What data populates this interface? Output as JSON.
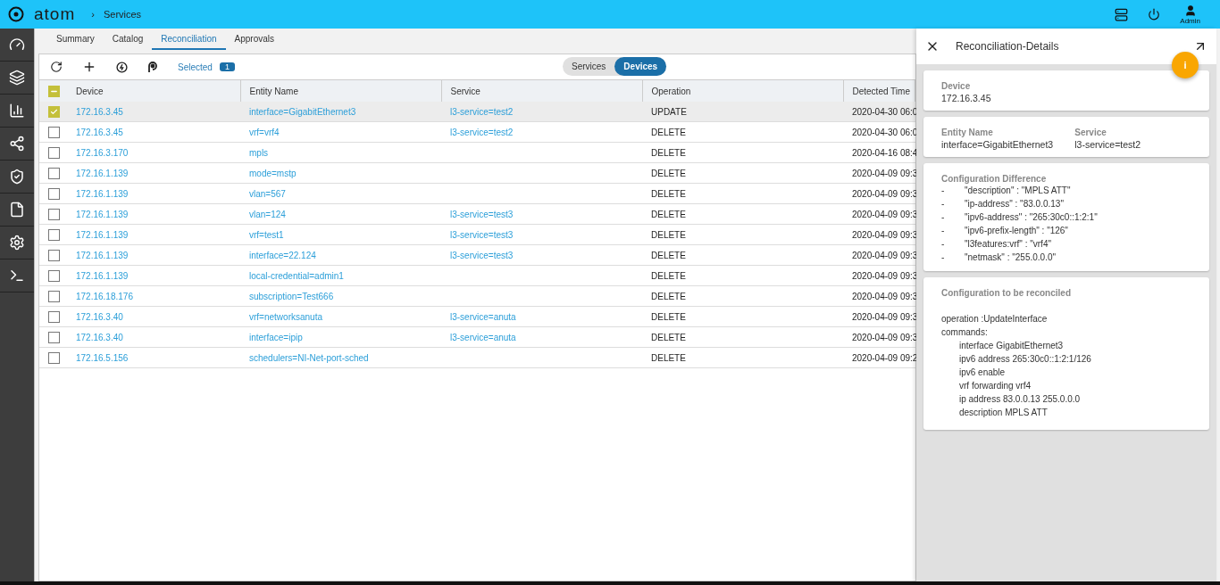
{
  "header": {
    "logo": "atom",
    "separator": "›",
    "breadcrumb": "Services",
    "user": "Admin"
  },
  "tabs": [
    {
      "label": "Summary",
      "selected": false
    },
    {
      "label": "Catalog",
      "selected": false
    },
    {
      "label": "Reconciliation",
      "selected": true
    },
    {
      "label": "Approvals",
      "selected": false
    }
  ],
  "toolbar": {
    "selected_label": "Selected",
    "selected_count": "1",
    "toggle": [
      {
        "label": "Services",
        "selected": false
      },
      {
        "label": "Devices",
        "selected": true
      }
    ]
  },
  "table": {
    "columns": [
      "Device",
      "Entity Name",
      "Service",
      "Operation",
      "Detected Time"
    ],
    "header_checkbox": {
      "partial": true
    },
    "rows": [
      {
        "checked": true,
        "device": "172.16.3.45",
        "entity": "interface=GigabitEthernet3",
        "service": "l3-service=test2",
        "operation": "UPDATE",
        "time": "2020-04-30 06:0"
      },
      {
        "checked": false,
        "device": "172.16.3.45",
        "entity": "vrf=vrf4",
        "service": "l3-service=test2",
        "operation": "DELETE",
        "time": "2020-04-30 06:0"
      },
      {
        "checked": false,
        "device": "172.16.3.170",
        "entity": "mpls",
        "operation": "DELETE",
        "time": "2020-04-16 08:4"
      },
      {
        "checked": false,
        "device": "172.16.1.139",
        "entity": "mode=mstp",
        "operation": "DELETE",
        "time": "2020-04-09 09:3"
      },
      {
        "checked": false,
        "device": "172.16.1.139",
        "entity": "vlan=567",
        "operation": "DELETE",
        "time": "2020-04-09 09:3"
      },
      {
        "checked": false,
        "device": "172.16.1.139",
        "entity": "vlan=124",
        "service": "l3-service=test3",
        "operation": "DELETE",
        "time": "2020-04-09 09:3"
      },
      {
        "checked": false,
        "device": "172.16.1.139",
        "entity": "vrf=test1",
        "service": "l3-service=test3",
        "operation": "DELETE",
        "time": "2020-04-09 09:3"
      },
      {
        "checked": false,
        "device": "172.16.1.139",
        "entity": "interface=22.124",
        "service": "l3-service=test3",
        "operation": "DELETE",
        "time": "2020-04-09 09:3"
      },
      {
        "checked": false,
        "device": "172.16.1.139",
        "entity": "local-credential=admin1",
        "operation": "DELETE",
        "time": "2020-04-09 09:3"
      },
      {
        "checked": false,
        "device": "172.16.18.176",
        "entity": "subscription=Test666",
        "operation": "DELETE",
        "time": "2020-04-09 09:3"
      },
      {
        "checked": false,
        "device": "172.16.3.40",
        "entity": "vrf=networksanuta",
        "service": "l3-service=anuta",
        "operation": "DELETE",
        "time": "2020-04-09 09:3"
      },
      {
        "checked": false,
        "device": "172.16.3.40",
        "entity": "interface=ipip",
        "service": "l3-service=anuta",
        "operation": "DELETE",
        "time": "2020-04-09 09:3"
      },
      {
        "checked": false,
        "device": "172.16.5.156",
        "entity": "schedulers=NI-Net-port-sched",
        "operation": "DELETE",
        "time": "2020-04-09 09:2"
      }
    ]
  },
  "details": {
    "title": "Reconciliation-Details",
    "info_label": "i",
    "device": {
      "label": "Device",
      "value": "172.16.3.45"
    },
    "entity": {
      "label": "Entity Name",
      "value": "interface=GigabitEthernet3"
    },
    "service": {
      "label": "Service",
      "value": "l3-service=test2"
    },
    "difference": {
      "title": "Configuration Difference",
      "lines": [
        {
          "mark": "-",
          "text": "\"description\" : \"MPLS ATT\""
        },
        {
          "mark": "-",
          "text": "\"ip-address\" : \"83.0.0.13\""
        },
        {
          "mark": "-",
          "text": "\"ipv6-address\" : \"265:30c0::1:2:1\""
        },
        {
          "mark": "-",
          "text": "\"ipv6-prefix-length\" : \"126\""
        },
        {
          "mark": "-",
          "text": "\"l3features:vrf\" : \"vrf4\""
        },
        {
          "mark": "-",
          "text": "\"netmask\" : \"255.0.0.0\""
        }
      ]
    },
    "reconcile": {
      "title": "Configuration to be reconciled",
      "operation": "operation :UpdateInterface",
      "commands_label": "commands:",
      "commands": [
        "interface GigabitEthernet3",
        "ipv6 address 265:30c0::1:2:1/126",
        "ipv6 enable",
        "vrf forwarding vrf4",
        "ip address 83.0.0.13 255.0.0.0",
        "description MPLS ATT"
      ]
    }
  }
}
